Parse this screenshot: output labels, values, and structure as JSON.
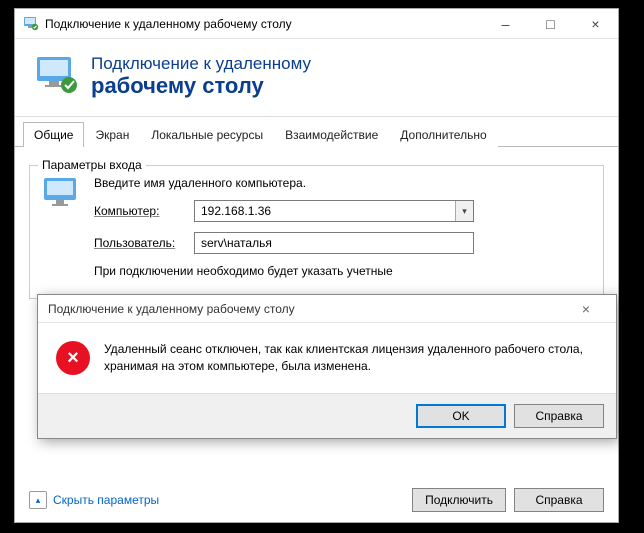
{
  "window": {
    "title": "Подключение к удаленному рабочему столу"
  },
  "header": {
    "line1": "Подключение к удаленному",
    "line2": "рабочему столу"
  },
  "tabs": {
    "general": "Общие",
    "display": "Экран",
    "local": "Локальные ресурсы",
    "experience": "Взаимодействие",
    "advanced": "Дополнительно"
  },
  "login": {
    "group_title": "Параметры входа",
    "instruction": "Введите имя удаленного компьютера.",
    "computer_label": "Компьютер:",
    "computer_value": "192.168.1.36",
    "user_label": "Пользователь:",
    "user_value": "serv\\наталья",
    "creds_note": "При подключении необходимо будет указать учетные"
  },
  "footer": {
    "toggle": "Скрыть параметры",
    "connect": "Подключить",
    "help": "Справка"
  },
  "dialog": {
    "title": "Подключение к удаленному рабочему столу",
    "message": "Удаленный сеанс отключен, так как клиентская лицензия удаленного рабочего стола, хранимая на этом компьютере, была изменена.",
    "ok": "OK",
    "help": "Справка"
  }
}
